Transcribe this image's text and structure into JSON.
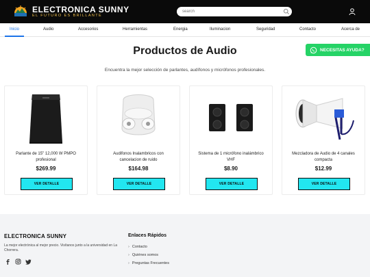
{
  "header": {
    "brand": "ELECTRONICA SUNNY",
    "tagline": "EL FUTURO ES BRILLANTE",
    "search_placeholder": "search"
  },
  "nav": {
    "items": [
      {
        "label": "Inicio",
        "active": true
      },
      {
        "label": "Audio",
        "active": false
      },
      {
        "label": "Accesorios",
        "active": false
      },
      {
        "label": "Herramientas",
        "active": false
      },
      {
        "label": "Energia",
        "active": false
      },
      {
        "label": "Iluminacion",
        "active": false
      },
      {
        "label": "Seguridad",
        "active": false
      },
      {
        "label": "Contacto",
        "active": false
      },
      {
        "label": "Acerca de",
        "active": false
      }
    ]
  },
  "page": {
    "title": "Productos de Audio",
    "subtitle": "Encuentra la mejor selección de parlantes, audífonos y micrófonos profesionales."
  },
  "whatsapp": {
    "label": "NECESITAS AYUDA?",
    "color": "#25d366"
  },
  "products": [
    {
      "name": "Parlante de 15\" 12,000 W PMPO profesional",
      "price": "$269.99",
      "button": "VER DETALLE",
      "icon": "speaker-icon"
    },
    {
      "name": "Audifonos Inalambricos con cancelacion de ruido",
      "price": "$164.98",
      "button": "VER DETALLE",
      "icon": "earbuds-icon"
    },
    {
      "name": "Sistema de 1 micrófono inalámbrico VHF",
      "price": "$8.90",
      "button": "VER DETALLE",
      "icon": "desktop-speakers-icon"
    },
    {
      "name": "Mezcladora de Audio de 4 canales compacta",
      "price": "$12.99",
      "button": "VER DETALLE",
      "icon": "megaphone-icon"
    }
  ],
  "footer": {
    "brand": "ELECTRONICA SUNNY",
    "description": "La mejor electrónica al mejor precio. Visítanos junto a la universidad en La Chorrera.",
    "links_title": "Enlaces Rápidos",
    "links": [
      "Contacto",
      "Quiénes somos",
      "Preguntas Frecuentes"
    ]
  },
  "colors": {
    "accent": "#1a73e8",
    "button": "#22e6f0",
    "topbar": "#0a0a0a"
  }
}
